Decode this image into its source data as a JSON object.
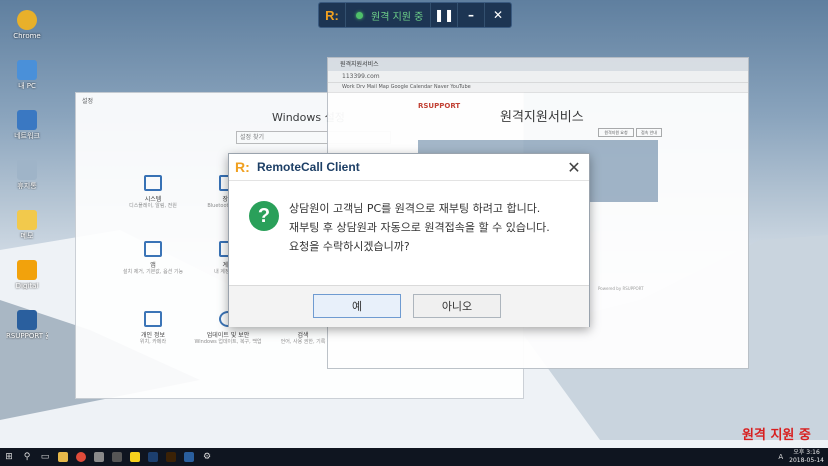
{
  "desktop": {
    "icons": [
      {
        "label": "Chrome",
        "color": "#e8b02a"
      },
      {
        "label": "내 PC",
        "color": "#4a90d9"
      },
      {
        "label": "네트워크",
        "color": "#3a78c2"
      },
      {
        "label": "휴지통",
        "color": "#9fb4c8"
      },
      {
        "label": "메모",
        "color": "#f2c94c"
      },
      {
        "label": "Digital",
        "color": "#f2a20c"
      },
      {
        "label": "RSUPPORT 원격지원",
        "color": "#2a5f9e"
      }
    ]
  },
  "remote_toolbar": {
    "logo": "R:",
    "status": "원격 지원 중",
    "pause_icon": "pause-icon",
    "minimize_icon": "minimize-icon",
    "close_icon": "close-icon"
  },
  "settings_window": {
    "title": "설정",
    "heading": "Windows 설정",
    "search_placeholder": "설정 찾기",
    "items": [
      {
        "title": "시스템",
        "sub": "디스플레이, 알림, 전원"
      },
      {
        "title": "장치",
        "sub": "Bluetooth, 프린터"
      },
      {
        "title": "앱",
        "sub": "설치 제거, 기본값, 옵션 기능"
      },
      {
        "title": "계정",
        "sub": "내 계정, 메일"
      },
      {
        "title": "개인 정보",
        "sub": "위치, 카메라"
      },
      {
        "title": "업데이트 및 보안",
        "sub": "Windows 업데이트, 복구, 백업"
      },
      {
        "title": "검색",
        "sub": "언어, 사용 권한, 기록"
      }
    ]
  },
  "browser_window": {
    "tab": "원격지원서비스",
    "address": "113399.com",
    "bookmarks": "Work  Drv  Mail  Map  Google  Calendar  Naver  YouTube",
    "brand": "RSUPPORT",
    "page_title": "원격지원서비스",
    "button1": "원격지원 요청",
    "button2": "접속 안내",
    "footer": "Powered by RSUPPORT"
  },
  "dialog": {
    "logo": "R:",
    "title": "RemoteCall Client",
    "question_icon": "question-icon",
    "message_lines": [
      "상담원이 고객님 PC를 원격으로 재부팅 하려고 합니다.",
      "재부팅 후 상담원과 자동으로 원격접속을 할 수 있습니다.",
      "요청을 수락하시겠습니까?"
    ],
    "yes_label": "예",
    "no_label": "아니오"
  },
  "watermark": "원격 지원 중",
  "taskbar": {
    "tray_lang": "A",
    "time": "오후 3:16",
    "date": "2018-05-14"
  },
  "colors": {
    "accent": "#1d3f66",
    "logo": "#f0a020",
    "question": "#2aa05a",
    "watermark": "#d81e1e"
  }
}
